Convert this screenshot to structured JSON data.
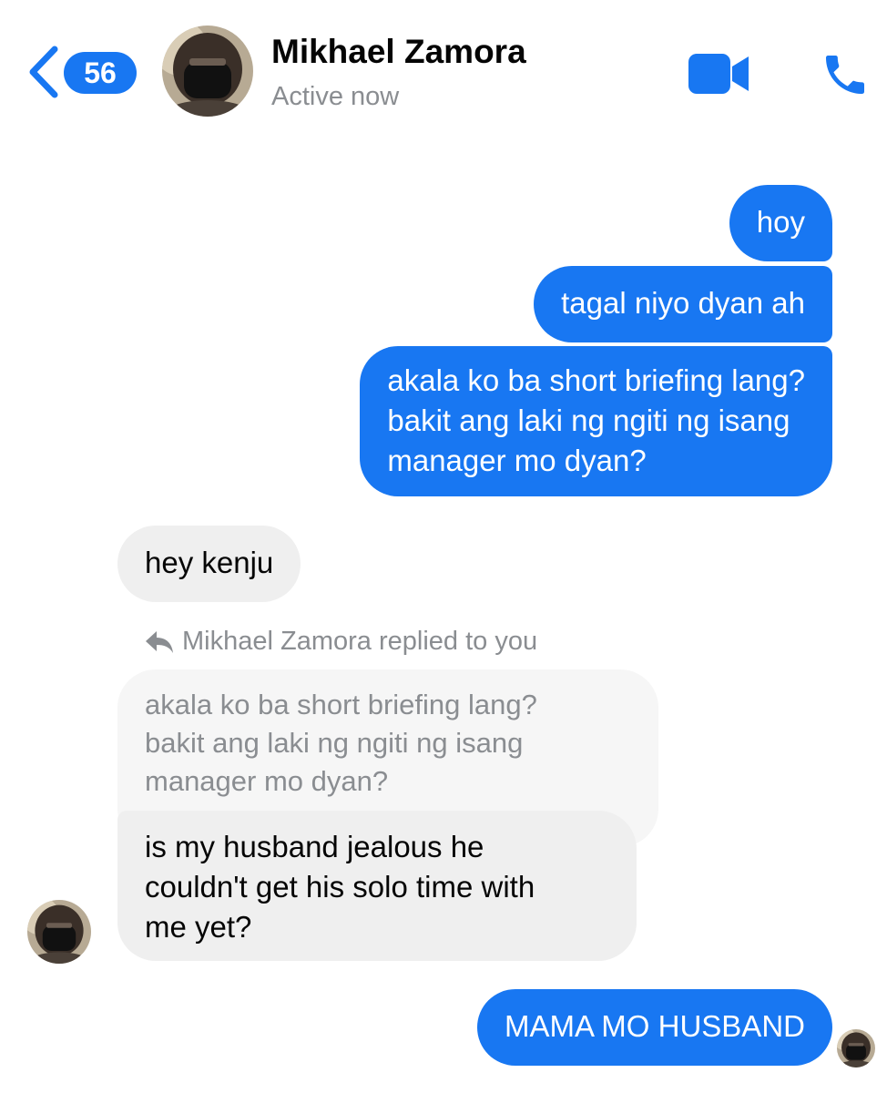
{
  "header": {
    "back_icon": "chevron-left-icon",
    "unread_count": "56",
    "contact_name": "Mikhael Zamora",
    "status": "Active now",
    "video_icon": "video-camera-icon",
    "phone_icon": "phone-icon"
  },
  "colors": {
    "accent": "#1877f2",
    "incoming_bubble": "#efefef",
    "quoted_bubble": "#f6f6f6",
    "muted_text": "#8a8d91"
  },
  "messages": {
    "m1": "hoy",
    "m2": "tagal niyo dyan ah",
    "m3": {
      "line1": "akala ko ba short briefing lang?",
      "line2": "bakit ang laki ng ngiti ng isang",
      "line3": "manager mo dyan?"
    },
    "m4": "hey kenju",
    "reply": {
      "header": "Mikhael Zamora replied to you",
      "quoted": {
        "line1": "akala ko ba short briefing lang?",
        "line2": "bakit ang laki ng ngiti ng isang",
        "line3": "manager mo dyan?"
      }
    },
    "m5": {
      "line1": "is my husband jealous he",
      "line2": "couldn't get his solo time with",
      "line3": "me yet?"
    },
    "m6": "MAMA MO HUSBAND"
  }
}
